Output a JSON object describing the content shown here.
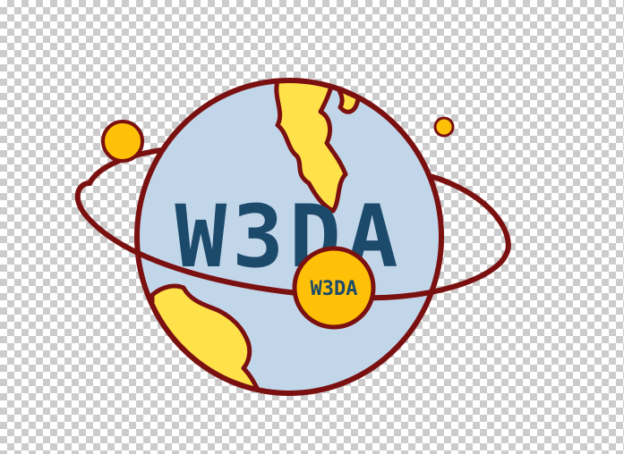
{
  "logo": {
    "main_text": "W3DA",
    "badge_text": "W3DA",
    "colors": {
      "ocean": "#c2d6ea",
      "land": "#ffe14a",
      "outline": "#7a1010",
      "text": "#1b4a6b",
      "moon": "#ffc107"
    }
  }
}
